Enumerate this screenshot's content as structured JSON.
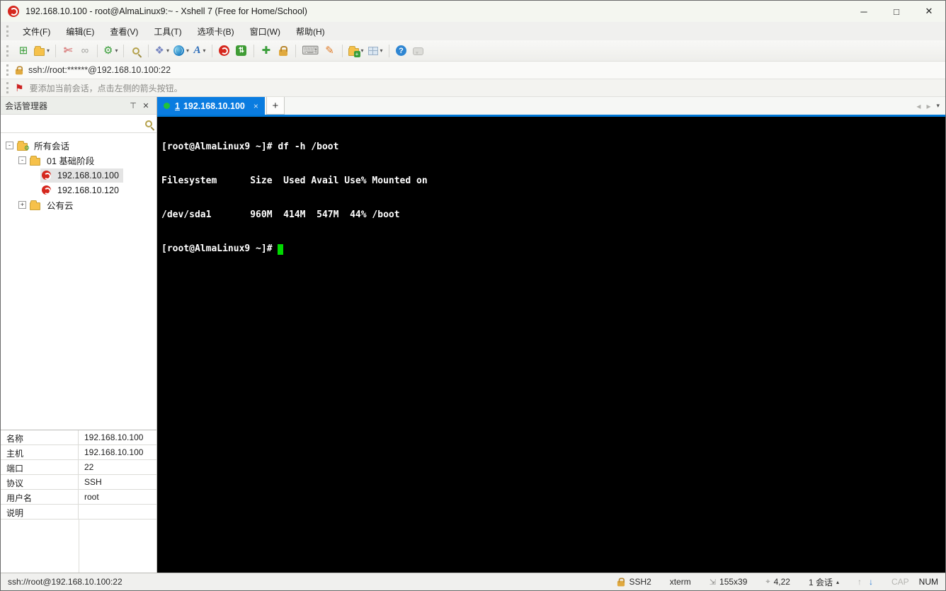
{
  "window": {
    "title": "192.168.10.100 - root@AlmaLinux9:~ - Xshell 7 (Free for Home/School)",
    "controls": {
      "minimize": "─",
      "maximize": "□",
      "close": "✕"
    }
  },
  "menu": {
    "items": [
      "文件(F)",
      "编辑(E)",
      "查看(V)",
      "工具(T)",
      "选项卡(B)",
      "窗口(W)",
      "帮助(H)"
    ]
  },
  "toolbar": {
    "dropdown": "▾",
    "icons": [
      {
        "name": "new-session",
        "glyph": "⊞"
      },
      {
        "name": "open-session-folder",
        "glyph": ""
      },
      {
        "name": "disconnect",
        "glyph": "✄"
      },
      {
        "name": "reconnect",
        "glyph": "∞"
      },
      {
        "name": "session-properties",
        "glyph": "⚙"
      },
      {
        "name": "find",
        "glyph": ""
      },
      {
        "name": "color-scheme",
        "glyph": "❖"
      },
      {
        "name": "web-browser",
        "glyph": ""
      },
      {
        "name": "font",
        "glyph": "A"
      },
      {
        "name": "xshell",
        "glyph": ""
      },
      {
        "name": "xftp-transfer",
        "glyph": "⇅"
      },
      {
        "name": "fullscreen",
        "glyph": "✚"
      },
      {
        "name": "lock-screen",
        "glyph": ""
      },
      {
        "name": "virtual-keyboard",
        "glyph": "⌨"
      },
      {
        "name": "compose-pen",
        "glyph": "✎"
      },
      {
        "name": "new-file",
        "glyph": "+"
      },
      {
        "name": "tile-windows",
        "glyph": ""
      },
      {
        "name": "help",
        "glyph": "?"
      },
      {
        "name": "chat",
        "glyph": ""
      }
    ]
  },
  "address_bar": {
    "value": "ssh://root:******@192.168.10.100:22"
  },
  "info_bar": {
    "flag": "⚑",
    "flag_arrow": "▸",
    "text": "要添加当前会话，点击左侧的箭头按钮。"
  },
  "session_manager": {
    "title": "会话管理器",
    "pin": "⊤",
    "close": "✕",
    "tree": {
      "root": {
        "expander": "-",
        "label": "所有会话"
      },
      "group": {
        "expander": "-",
        "label": "01 基础阶段"
      },
      "session1": {
        "label": "192.168.10.100"
      },
      "session2": {
        "label": "192.168.10.120"
      },
      "cloud": {
        "expander": "+",
        "label": "公有云"
      }
    }
  },
  "properties": {
    "rows": [
      {
        "label": "名称",
        "value": "192.168.10.100"
      },
      {
        "label": "主机",
        "value": "192.168.10.100"
      },
      {
        "label": "端口",
        "value": "22"
      },
      {
        "label": "协议",
        "value": "SSH"
      },
      {
        "label": "用户名",
        "value": "root"
      },
      {
        "label": "说明",
        "value": ""
      }
    ]
  },
  "tab_bar": {
    "active_tab": {
      "index": "1",
      "label": "192.168.10.100",
      "close": "×"
    },
    "new_tab": "+",
    "nav_left": "◂",
    "nav_right": "▸",
    "nav_menu": "▾"
  },
  "terminal": {
    "lines": [
      "[root@AlmaLinux9 ~]# df -h /boot",
      "Filesystem      Size  Used Avail Use% Mounted on",
      "/dev/sda1       960M  414M  547M  44% /boot",
      "[root@AlmaLinux9 ~]# "
    ],
    "cursor_color": "#00d800",
    "background": "#000000",
    "foreground": "#ffffff"
  },
  "status_bar": {
    "left": "ssh://root@192.168.10.100:22",
    "protocol": "SSH2",
    "terminal_type": "xterm",
    "size_icon": "⇲",
    "screen_size": "155x39",
    "position_icon": "⌖",
    "cursor_position": "4,22",
    "session_count": "1 会话",
    "session_menu": "▴",
    "arrow_up": "↑",
    "arrow_down": "↓",
    "caps": "CAP",
    "num": "NUM"
  },
  "colors": {
    "accent_blue": "#0a7ce0",
    "tab_strip": "#0078d7",
    "xshell_red": "#d5281e",
    "cursor_green": "#00d800"
  }
}
